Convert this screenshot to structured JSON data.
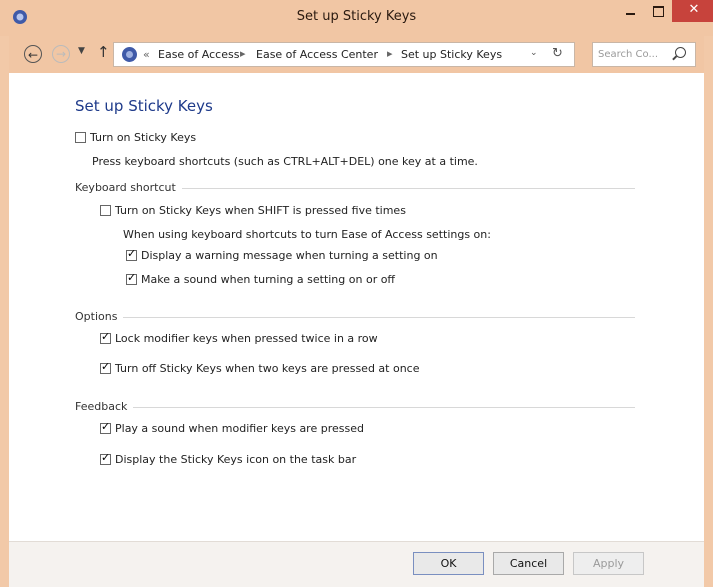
{
  "window": {
    "title": "Set up Sticky Keys"
  },
  "nav": {
    "breadcrumbs": [
      "Ease of Access",
      "Ease of Access Center",
      "Set up Sticky Keys"
    ],
    "overflow": "«",
    "search_placeholder": "Search Co..."
  },
  "page": {
    "title": "Set up Sticky Keys",
    "turn_on": {
      "label": "Turn on Sticky Keys",
      "checked": false
    },
    "turn_on_desc": "Press keyboard shortcuts (such as CTRL+ALT+DEL) one key at a time.",
    "keyboard_shortcut": {
      "heading": "Keyboard shortcut",
      "shift_five": {
        "label": "Turn on Sticky Keys when SHIFT is pressed five times",
        "checked": false
      },
      "when_using": "When using keyboard shortcuts to turn Ease of Access settings on:",
      "warning": {
        "label": "Display a warning message when turning a setting on",
        "checked": true
      },
      "sound": {
        "label": "Make a sound when turning a setting on or off",
        "checked": true
      }
    },
    "options": {
      "heading": "Options",
      "lock_modifier": {
        "label": "Lock modifier keys when pressed twice in a row",
        "checked": true
      },
      "turn_off_two": {
        "label": "Turn off Sticky Keys when two keys are pressed at once",
        "checked": true
      }
    },
    "feedback": {
      "heading": "Feedback",
      "play_sound": {
        "label": "Play a sound when modifier keys are pressed",
        "checked": true
      },
      "display_icon": {
        "label": "Display the Sticky Keys icon on the task bar",
        "checked": true
      }
    }
  },
  "footer": {
    "ok": "OK",
    "cancel": "Cancel",
    "apply": "Apply"
  }
}
